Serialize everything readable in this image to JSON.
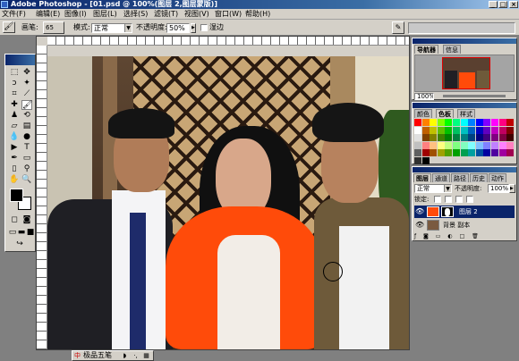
{
  "window": {
    "title": "Adobe Photoshop - [01.psd @ 100%(图层 2,图层蒙版)]",
    "min_label": "_",
    "max_label": "□",
    "close_label": "×"
  },
  "menu": [
    {
      "label": "文件(F)"
    },
    {
      "label": "编辑(E)"
    },
    {
      "label": "图像(I)"
    },
    {
      "label": "图层(L)"
    },
    {
      "label": "选择(S)"
    },
    {
      "label": "滤镜(T)"
    },
    {
      "label": "视图(V)"
    },
    {
      "label": "窗口(W)"
    },
    {
      "label": "帮助(H)"
    }
  ],
  "options": {
    "brush_label": "画笔:",
    "brush_size": "65",
    "mode_label": "模式:",
    "mode_value": "正常",
    "opacity_label": "不透明度:",
    "opacity_value": "50%",
    "wet_edges_label": "湿边"
  },
  "navigator": {
    "tabs": [
      "导航器",
      "信息"
    ],
    "zoom": "100%"
  },
  "colors": {
    "tabs": [
      "颜色",
      "色板",
      "样式"
    ],
    "swatches": [
      "#ff0000",
      "#ff8000",
      "#ffff00",
      "#80ff00",
      "#00ff00",
      "#00ff80",
      "#00ffff",
      "#0080ff",
      "#0000ff",
      "#8000ff",
      "#ff00ff",
      "#ff0080",
      "#c00000",
      "#ffffff",
      "#c06000",
      "#c0c000",
      "#60c000",
      "#00c000",
      "#00c060",
      "#00c0c0",
      "#0060c0",
      "#0000c0",
      "#6000c0",
      "#c000c0",
      "#c00060",
      "#800000",
      "#e0e0e0",
      "#804000",
      "#808000",
      "#408000",
      "#008000",
      "#008040",
      "#008080",
      "#004080",
      "#000080",
      "#400080",
      "#800080",
      "#800040",
      "#400000",
      "#c0c0c0",
      "#ff8080",
      "#ffc080",
      "#ffff80",
      "#c0ff80",
      "#80ff80",
      "#80ffc0",
      "#80ffff",
      "#80c0ff",
      "#8080ff",
      "#c080ff",
      "#ff80ff",
      "#ff80c0",
      "#606060",
      "#a00000",
      "#a05000",
      "#a0a000",
      "#50a000",
      "#00a000",
      "#00a050",
      "#00a0a0",
      "#0050a0",
      "#0000a0",
      "#5000a0",
      "#a000a0",
      "#a00050",
      "#303030",
      "#000000"
    ]
  },
  "layers": {
    "tabs": [
      "图层",
      "通道",
      "路径",
      "历史",
      "动作"
    ],
    "blend_mode": "正常",
    "opacity_label": "不透明度:",
    "opacity_value": "100%",
    "lock_label": "锁定:",
    "rows": [
      {
        "name": "图层 2"
      },
      {
        "name": "背景 副本"
      }
    ]
  },
  "ime": {
    "label": "极品五笔"
  },
  "icons": {
    "photoshop": "photoshop-icon",
    "brush": "brush-icon",
    "eye": "eye-icon"
  }
}
